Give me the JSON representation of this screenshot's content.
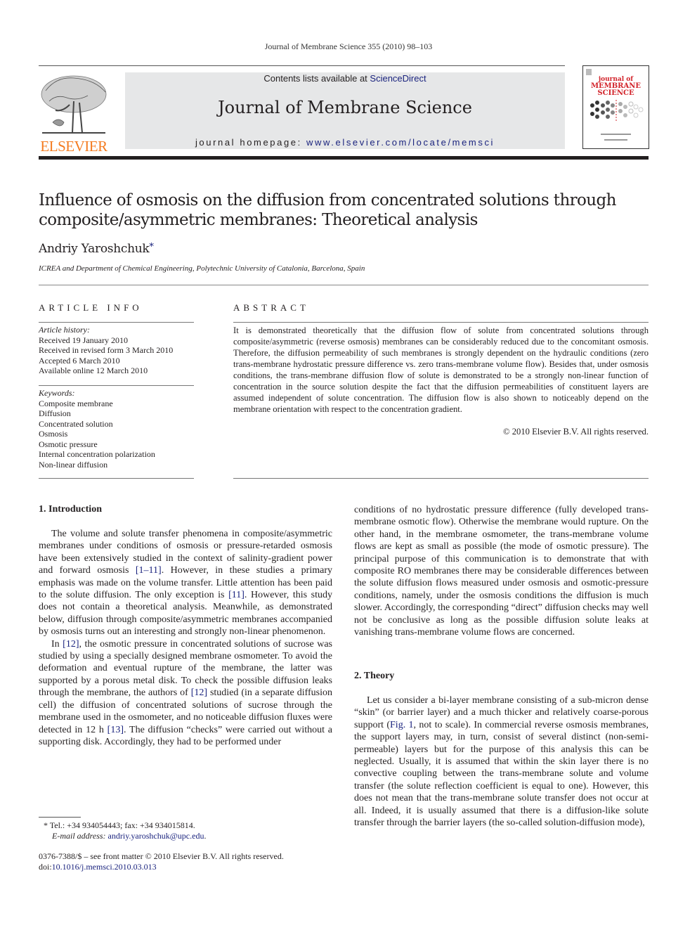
{
  "header": {
    "citation": "Journal of Membrane Science 355 (2010) 98–103",
    "contents_prefix": "Contents lists available at ",
    "contents_link": "ScienceDirect",
    "journal_title": "Journal of Membrane Science",
    "homepage_prefix": "journal homepage: ",
    "homepage_link": "www.elsevier.com/locate/memsci",
    "publisher_logo_text": "ELSEVIER",
    "cover_title_lines": [
      "journal of",
      "MEMBRANE",
      "SCIENCE"
    ],
    "colors": {
      "publisher_orange": "#f47b20",
      "link_blue": "#1a237e",
      "cover_red": "#d2232a",
      "band_gray": "#e6e7e8"
    }
  },
  "article": {
    "title_line1": "Influence of osmosis on the diffusion from concentrated solutions through",
    "title_line2": "composite/asymmetric membranes: Theoretical analysis",
    "author": "Andriy Yaroshchuk",
    "author_mark": "*",
    "affiliation": "ICREA and Department of Chemical Engineering, Polytechnic University of Catalonia, Barcelona, Spain"
  },
  "article_info": {
    "heading": "ARTICLE INFO",
    "history_label": "Article history:",
    "history": [
      "Received 19 January 2010",
      "Received in revised form 3 March 2010",
      "Accepted 6 March 2010",
      "Available online 12 March 2010"
    ],
    "keywords_label": "Keywords:",
    "keywords": [
      "Composite membrane",
      "Diffusion",
      "Concentrated solution",
      "Osmosis",
      "Osmotic pressure",
      "Internal concentration polarization",
      "Non-linear diffusion"
    ]
  },
  "abstract": {
    "heading": "ABSTRACT",
    "text": "It is demonstrated theoretically that the diffusion flow of solute from concentrated solutions through composite/asymmetric (reverse osmosis) membranes can be considerably reduced due to the concomitant osmosis. Therefore, the diffusion permeability of such membranes is strongly dependent on the hydraulic conditions (zero trans-membrane hydrostatic pressure difference vs. zero trans-membrane volume flow). Besides that, under osmosis conditions, the trans-membrane diffusion flow of solute is demonstrated to be a strongly non-linear function of concentration in the source solution despite the fact that the diffusion permeabilities of constituent layers are assumed independent of solute concentration. The diffusion flow is also shown to noticeably depend on the membrane orientation with respect to the concentration gradient.",
    "copyright": "© 2010 Elsevier B.V. All rights reserved."
  },
  "sections": {
    "intro_heading": "1.  Introduction",
    "intro_p1_a": "The volume and solute transfer phenomena in composite/asymmetric membranes under conditions of osmosis or pressure-retarded osmosis have been extensively studied in the context of salinity-gradient power and forward osmosis ",
    "intro_p1_ref1": "[1–11]",
    "intro_p1_b": ". However, in these studies a primary emphasis was made on the volume transfer. Little attention has been paid to the solute diffusion. The only exception is ",
    "intro_p1_ref2": "[11]",
    "intro_p1_c": ". However, this study does not contain a theoretical analysis. Meanwhile, as demonstrated below, diffusion through composite/asymmetric membranes accompanied by osmosis turns out an interesting and strongly non-linear phenomenon.",
    "intro_p2_a": "In ",
    "intro_p2_ref1": "[12]",
    "intro_p2_b": ", the osmotic pressure in concentrated solutions of sucrose was studied by using a specially designed membrane osmometer. To avoid the deformation and eventual rupture of the membrane, the latter was supported by a porous metal disk. To check the possible diffusion leaks through the membrane, the authors of ",
    "intro_p2_ref2": "[12]",
    "intro_p2_c": " studied (in a separate diffusion cell) the diffusion of concentrated solutions of sucrose through the membrane used in the osmometer, and no noticeable diffusion fluxes were detected in 12 h ",
    "intro_p2_ref3": "[13]",
    "intro_p2_d": ". The diffusion “checks” were carried out without a supporting disk. Accordingly, they had to be performed under",
    "right_p1": "conditions of no hydrostatic pressure difference (fully developed trans-membrane osmotic flow). Otherwise the membrane would rupture. On the other hand, in the membrane osmometer, the trans-membrane volume flows are kept as small as possible (the mode of osmotic pressure). The principal purpose of this communication is to demonstrate that with composite RO membranes there may be considerable differences between the solute diffusion flows measured under osmosis and osmotic-pressure conditions, namely, under the osmosis conditions the diffusion is much slower. Accordingly, the corresponding “direct” diffusion checks may well not be conclusive as long as the possible diffusion solute leaks at vanishing trans-membrane volume flows are concerned.",
    "theory_heading": "2.  Theory",
    "theory_p1_a": "Let us consider a bi-layer membrane consisting of a sub-micron dense “skin” (or barrier layer) and a much thicker and relatively coarse-porous support (",
    "theory_p1_ref": "Fig. 1",
    "theory_p1_b": ", not to scale). In commercial reverse osmosis membranes, the support layers may, in turn, consist of several distinct (non-semi-permeable) layers but for the purpose of this analysis this can be neglected. Usually, it is assumed that within the skin layer there is no convective coupling between the trans-membrane solute and volume transfer (the solute reflection coefficient is equal to one). However, this does not mean that the trans-membrane solute transfer does not occur at all. Indeed, it is usually assumed that there is a diffusion-like solute transfer through the barrier layers (the so-called solution-diffusion mode),"
  },
  "footer": {
    "footnote_mark": "*",
    "contact": " Tel.: +34 934054443; fax: +34 934015814.",
    "email_label": "E-mail address: ",
    "email": "andriy.yaroshchuk@upc.edu",
    "email_end": ".",
    "issn": "0376-7388/$ – see front matter © 2010 Elsevier B.V. All rights reserved.",
    "doi_label": "doi:",
    "doi": "10.1016/j.memsci.2010.03.013"
  }
}
